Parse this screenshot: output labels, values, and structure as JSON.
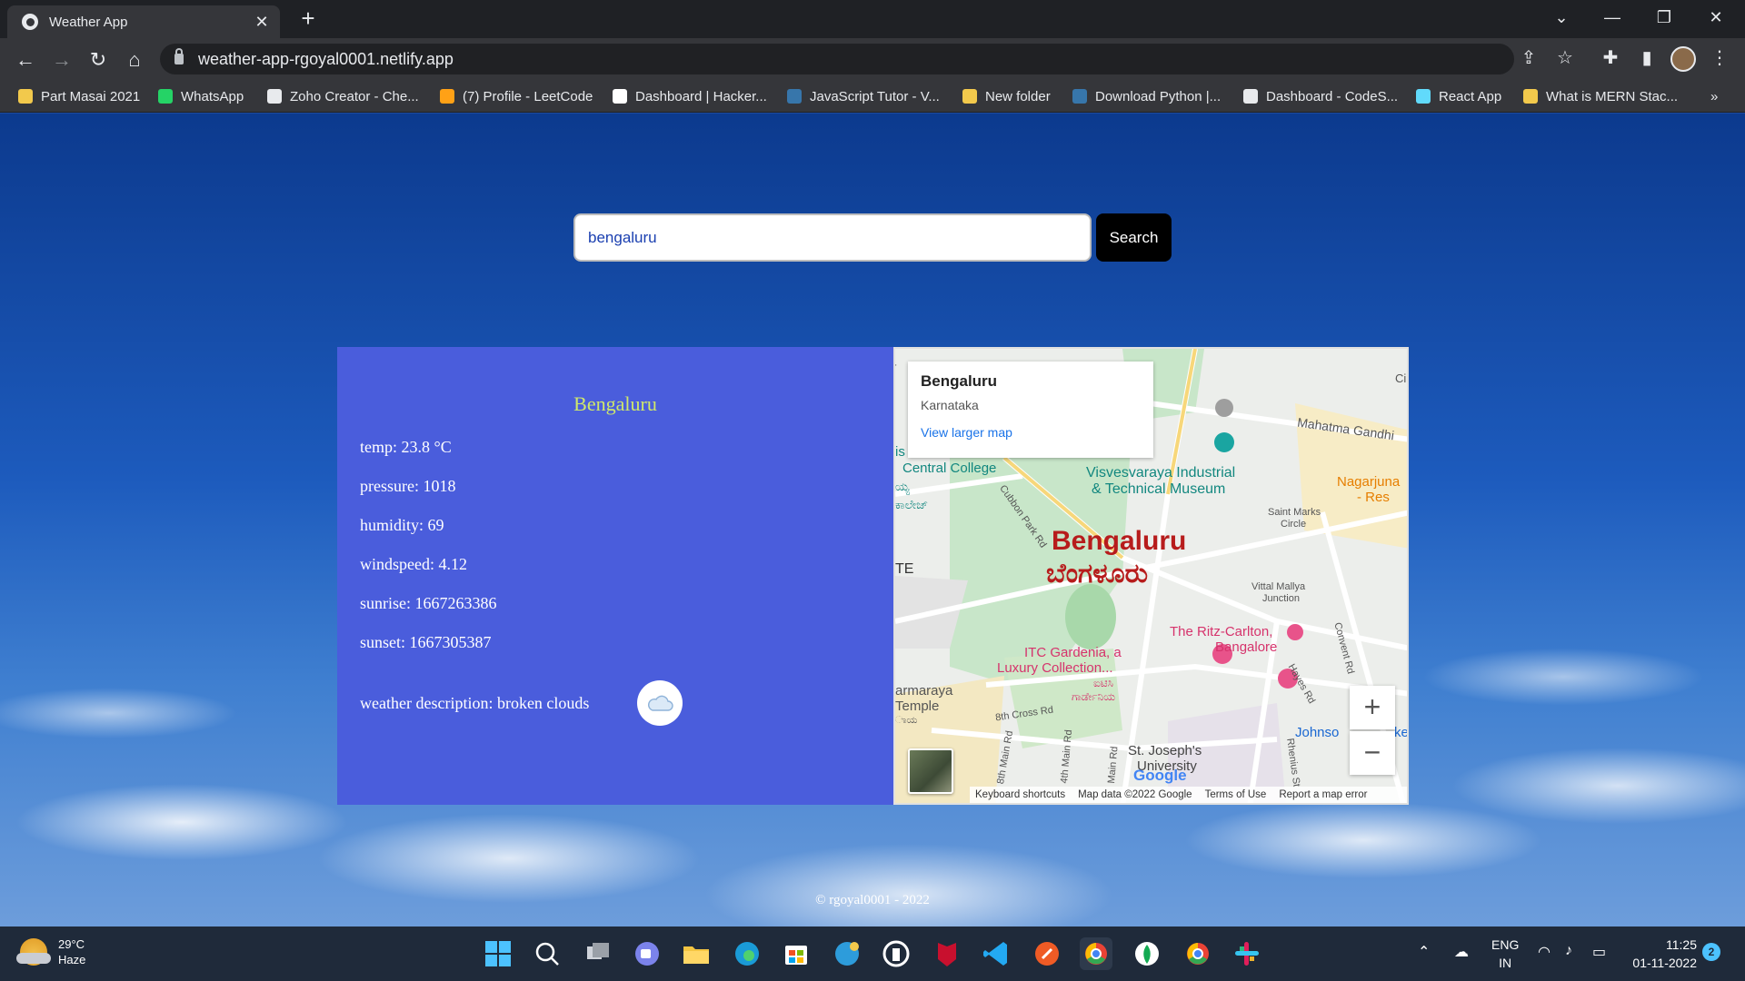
{
  "browser": {
    "tab_title": "Weather App",
    "url": "weather-app-rgoyal0001.netlify.app",
    "bookmarks": [
      {
        "label": "Part Masai 2021",
        "color": "#f2c94c"
      },
      {
        "label": "WhatsApp",
        "color": "#25d366"
      },
      {
        "label": "Zoho Creator - Che...",
        "color": "#e8eaed"
      },
      {
        "label": "(7) Profile - LeetCode",
        "color": "#ffa116"
      },
      {
        "label": "Dashboard | Hacker...",
        "color": "#ffffff"
      },
      {
        "label": "JavaScript Tutor - V...",
        "color": "#3776ab"
      },
      {
        "label": "New folder",
        "color": "#f2c94c"
      },
      {
        "label": "Download Python |...",
        "color": "#3776ab"
      },
      {
        "label": "Dashboard - CodeS...",
        "color": "#e8eaed"
      },
      {
        "label": "React App",
        "color": "#61dafb"
      },
      {
        "label": "What is MERN Stac...",
        "color": "#f2c94c"
      }
    ],
    "more_bookmarks": "»"
  },
  "search": {
    "value": "bengaluru",
    "button_label": "Search"
  },
  "weather": {
    "city": "Bengaluru",
    "temp": "temp: 23.8 °C",
    "pressure": "pressure: 1018",
    "humidity": "humidity: 69",
    "windspeed": "windspeed: 4.12",
    "sunrise": "sunrise: 1667263386",
    "sunset": "sunset: 1667305387",
    "description": "weather description: broken clouds",
    "icon": "broken-clouds-icon"
  },
  "map": {
    "info_name": "Bengaluru",
    "info_region": "Karnataka",
    "info_link": "View larger map",
    "labels": {
      "city_en": "Bengaluru",
      "city_kn": "ಬೆಂಗಳೂರು",
      "museum_line1": "Visvesvaraya Industrial",
      "museum_line2": "& Technical Museum",
      "central_college": "Central College",
      "cubbon": "Cubbon Park Rd",
      "mg_road": "Mahatma Gandhi",
      "nagarjuna": "Nagarjuna",
      "nagarjuna2": "- Res",
      "saint_marks": "Saint Marks",
      "saint_marks2": "Circle",
      "vittal": "Vittal Mallya",
      "vittal2": "Junction",
      "ritz1": "The Ritz-Carlton,",
      "ritz2": "Bangalore",
      "itc1": "ITC Gardenia, a",
      "itc2": "Luxury Collection...",
      "itc_kn1": "ಐಟಿಸಿ",
      "itc_kn2": "ಗಾರ್ಡೇನಿಯ",
      "armaraya": "armaraya",
      "temple": "Temple",
      "eighth_cross": "8th Cross Rd",
      "eighth_main": "8th Main Rd",
      "fourth_main": "4th Main Rd",
      "main_rd": "Main Rd",
      "st_josephs1": "St. Joseph's",
      "st_josephs2": "University",
      "johnson": "Johnso",
      "hayes": "Hayes Rd",
      "convent": "Convent Rd",
      "rhenius": "Rhenius St",
      "te": "TE",
      "is": "is",
      "college_kn": "ಕಾಲೇಜ್",
      "edge_kn": "ಯ್ಯ",
      "temple_kn": "ಾಯ",
      "rd": "Rd",
      "ci": "Ci",
      "ke": "ke",
      "google": "Google"
    },
    "zoom_in": "+",
    "zoom_out": "−",
    "footer": {
      "shortcuts": "Keyboard shortcuts",
      "data": "Map data ©2022 Google",
      "terms": "Terms of Use",
      "report": "Report a map error"
    }
  },
  "footer_text": "© rgoyal0001 - 2022",
  "taskbar": {
    "weather_temp": "29°C",
    "weather_cond": "Haze",
    "lang1": "ENG",
    "lang2": "IN",
    "time": "11:25",
    "date": "01-11-2022",
    "notifications": "2"
  }
}
